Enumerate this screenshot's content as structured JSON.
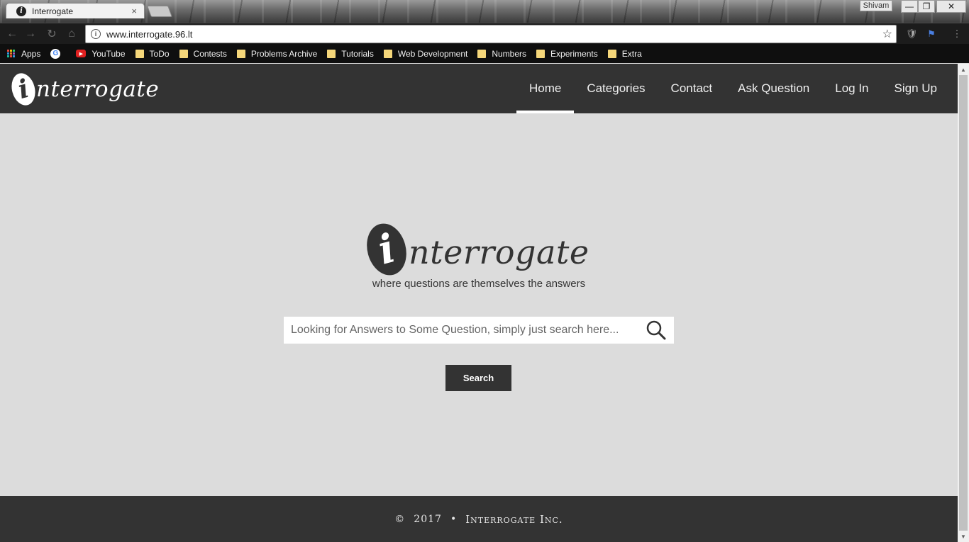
{
  "browser": {
    "tab_title": "Interrogate",
    "tab_close": "×",
    "profile_name": "Shivam",
    "url": "www.interrogate.96.lt",
    "window_controls": {
      "minimize": "—",
      "maximize": "❐",
      "close": "✕"
    },
    "bookmarks": [
      {
        "label": "Apps",
        "icon": "apps-grid-icon"
      },
      {
        "label": "",
        "icon": "google-icon"
      },
      {
        "label": "YouTube",
        "icon": "youtube-icon"
      },
      {
        "label": "ToDo",
        "icon": "folder-icon"
      },
      {
        "label": "Contests",
        "icon": "folder-icon"
      },
      {
        "label": "Problems Archive",
        "icon": "folder-icon"
      },
      {
        "label": "Tutorials",
        "icon": "folder-icon"
      },
      {
        "label": "Web Development",
        "icon": "folder-icon"
      },
      {
        "label": "Numbers",
        "icon": "folder-icon"
      },
      {
        "label": "Experiments",
        "icon": "folder-icon"
      },
      {
        "label": "Extra",
        "icon": "folder-icon"
      }
    ]
  },
  "header": {
    "logo_letter": "i",
    "logo_text": "nterrogate",
    "nav": [
      {
        "label": "Home",
        "active": true
      },
      {
        "label": "Categories",
        "active": false
      },
      {
        "label": "Contact",
        "active": false
      },
      {
        "label": "Ask Question",
        "active": false
      },
      {
        "label": "Log In",
        "active": false
      },
      {
        "label": "Sign Up",
        "active": false
      }
    ]
  },
  "hero": {
    "logo_letter": "i",
    "logo_text": "nterrogate",
    "tagline": "where questions are themselves the answers",
    "search_placeholder": "Looking for Answers to Some Question, simply just search here...",
    "search_button": "Search"
  },
  "footer": {
    "copyright": "©",
    "year": "2017",
    "separator": "•",
    "company": "Interrogate Inc."
  },
  "colors": {
    "header_bg": "#333333",
    "page_bg": "#dcdcdc",
    "button_bg": "#333333"
  }
}
